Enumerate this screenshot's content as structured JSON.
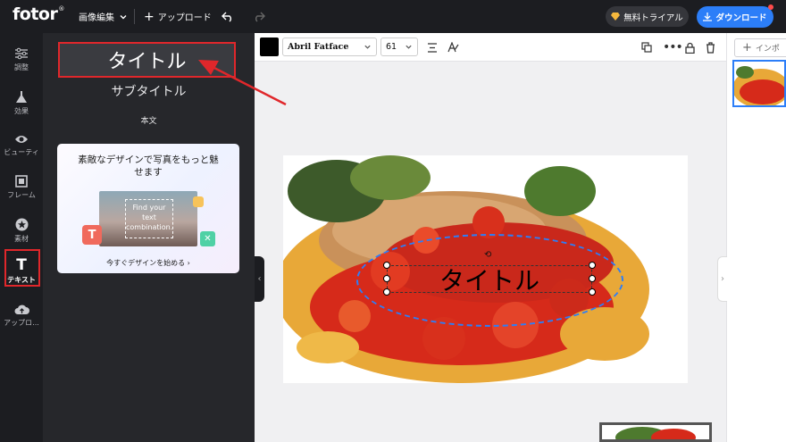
{
  "header": {
    "logo": "fotor",
    "logo_mark": "®",
    "menu_label": "画像編集",
    "upload_label": "アップロード",
    "trial_label": "無料トライアル",
    "download_label": "ダウンロード"
  },
  "sidebar": {
    "items": [
      {
        "label": "調整",
        "icon": "sliders-icon"
      },
      {
        "label": "効果",
        "icon": "flask-icon"
      },
      {
        "label": "ビューティ",
        "icon": "eye-icon"
      },
      {
        "label": "フレーム",
        "icon": "frame-icon"
      },
      {
        "label": "素材",
        "icon": "star-icon"
      },
      {
        "label": "テキスト",
        "icon": "text-icon"
      },
      {
        "label": "アップロ...",
        "icon": "cloud-upload-icon"
      }
    ],
    "active": "テキスト"
  },
  "text_panel": {
    "title_label": "タイトル",
    "subtitle_label": "サブタイトル",
    "body_label": "本文",
    "promo": {
      "heading": "素敵なデザインで写真をもっと魅せます",
      "sample_text": "Find your text combination.",
      "cta": "今すぐデザインを始める"
    }
  },
  "toolbar": {
    "font_name": "Abril Fatface",
    "font_size": "61"
  },
  "canvas": {
    "text": "タイトル"
  },
  "right_panel": {
    "insert_label": "インポ"
  },
  "colors": {
    "accent": "#2c7ef8",
    "highlight": "#e0272b",
    "dark_bg": "#1c1d21"
  }
}
